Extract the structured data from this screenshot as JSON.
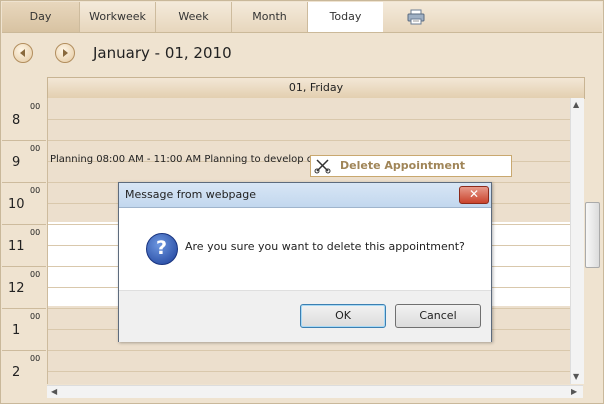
{
  "toolbar": {
    "tabs": [
      {
        "label": "Day",
        "active": true
      },
      {
        "label": "Workweek"
      },
      {
        "label": "Week"
      },
      {
        "label": "Month"
      },
      {
        "label": "Today"
      }
    ],
    "print_icon": "printer-icon"
  },
  "navigation": {
    "prev_icon": "arrow-left-circle-icon",
    "next_icon": "arrow-right-circle-icon",
    "date_title": "January - 01, 2010"
  },
  "day_header": {
    "label": "01, Friday"
  },
  "time_slots": [
    {
      "hour": "8",
      "minutes": "00"
    },
    {
      "hour": "9",
      "minutes": "00"
    },
    {
      "hour": "10",
      "minutes": "00"
    },
    {
      "hour": "11",
      "minutes": "00"
    },
    {
      "hour": "12",
      "minutes": "00"
    },
    {
      "hour": "1",
      "minutes": "00"
    },
    {
      "hour": "2",
      "minutes": "00"
    }
  ],
  "appointment": {
    "text": "Planning 08:00 AM - 11:00 AM Planning to develop co"
  },
  "context_menu": {
    "items": [
      {
        "label": "Delete Appointment",
        "icon": "scissors-icon"
      }
    ]
  },
  "dialog": {
    "title": "Message from webpage",
    "message": "Are you sure you want to delete this appointment?",
    "icon": "question-icon",
    "ok_label": "OK",
    "cancel_label": "Cancel",
    "close_glyph": "✕"
  },
  "colors": {
    "accent": "#a08558",
    "background": "#efe3d0",
    "dialog_title": "#c2d7ee"
  }
}
